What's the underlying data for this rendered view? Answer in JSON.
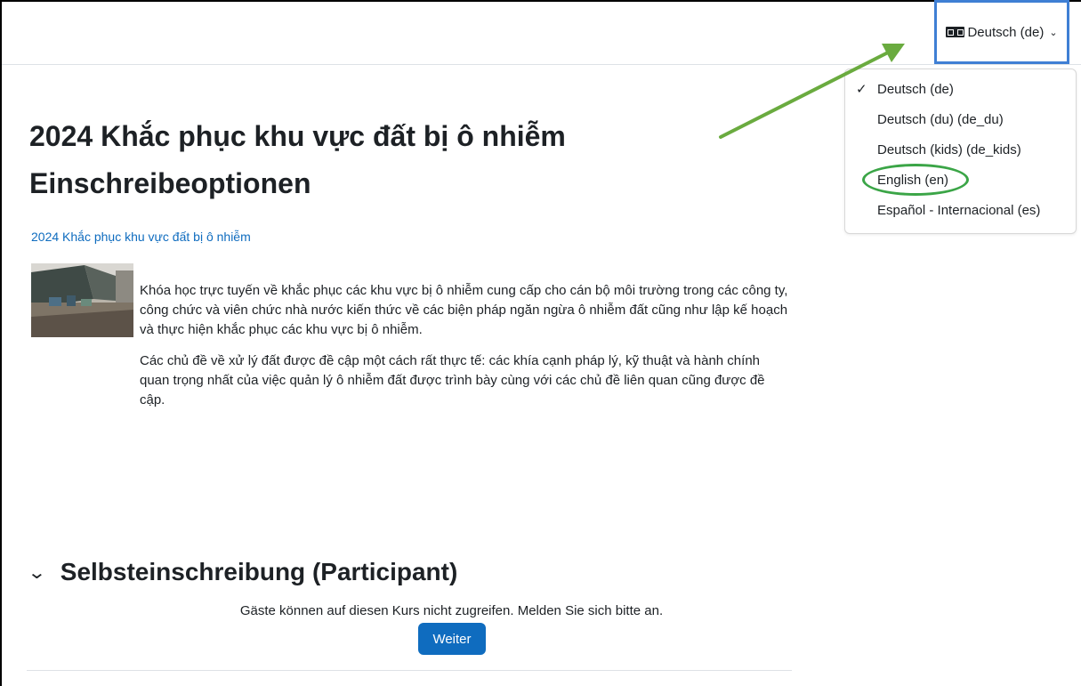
{
  "navbar": {
    "language_button_label": "Deutsch (de)"
  },
  "language_menu": {
    "items": [
      {
        "label": "Deutsch (de)",
        "selected": true
      },
      {
        "label": "Deutsch (du) (de_du)",
        "selected": false
      },
      {
        "label": "Deutsch (kids) (de_kids)",
        "selected": false
      },
      {
        "label": "English (en)",
        "selected": false,
        "highlighted": true
      },
      {
        "label": "Español - Internacional (es)",
        "selected": false
      }
    ]
  },
  "page": {
    "title": "2024 Khắc phục khu vực đất bị ô nhiễm",
    "subtitle": "Einschreibeoptionen",
    "course_link": "2024 Khắc phục khu vực đất bị ô nhiễm",
    "summary_paragraphs": [
      "Khóa học trực tuyến về khắc phục các khu vực bị ô nhiễm cung cấp cho cán bộ môi trường trong các công ty, công chức và viên chức nhà nước kiến thức về các biện pháp ngăn ngừa ô nhiễm đất cũng như lập kế hoạch và thực hiện khắc phục các khu vực bị ô nhiễm.",
      "Các chủ đề về xử lý đất được đề cập một cách rất thực tế: các khía cạnh pháp lý, kỹ thuật và hành chính quan trọng nhất của việc quản lý ô nhiễm đất được trình bày cùng với các chủ đề liên quan cũng được đề cập."
    ]
  },
  "enrolment": {
    "section_title": "Selbsteinschreibung (Participant)",
    "guest_message": "Gäste können auf diesen Kurs nicht zugreifen. Melden Sie sich bitte an.",
    "continue_button": "Weiter"
  },
  "colors": {
    "link": "#0f6cbf",
    "primary_button": "#0f6cbf",
    "annotation_arrow": "#6aab3f",
    "annotation_ring": "#3ba547",
    "button_outline": "#3f7fd4"
  }
}
